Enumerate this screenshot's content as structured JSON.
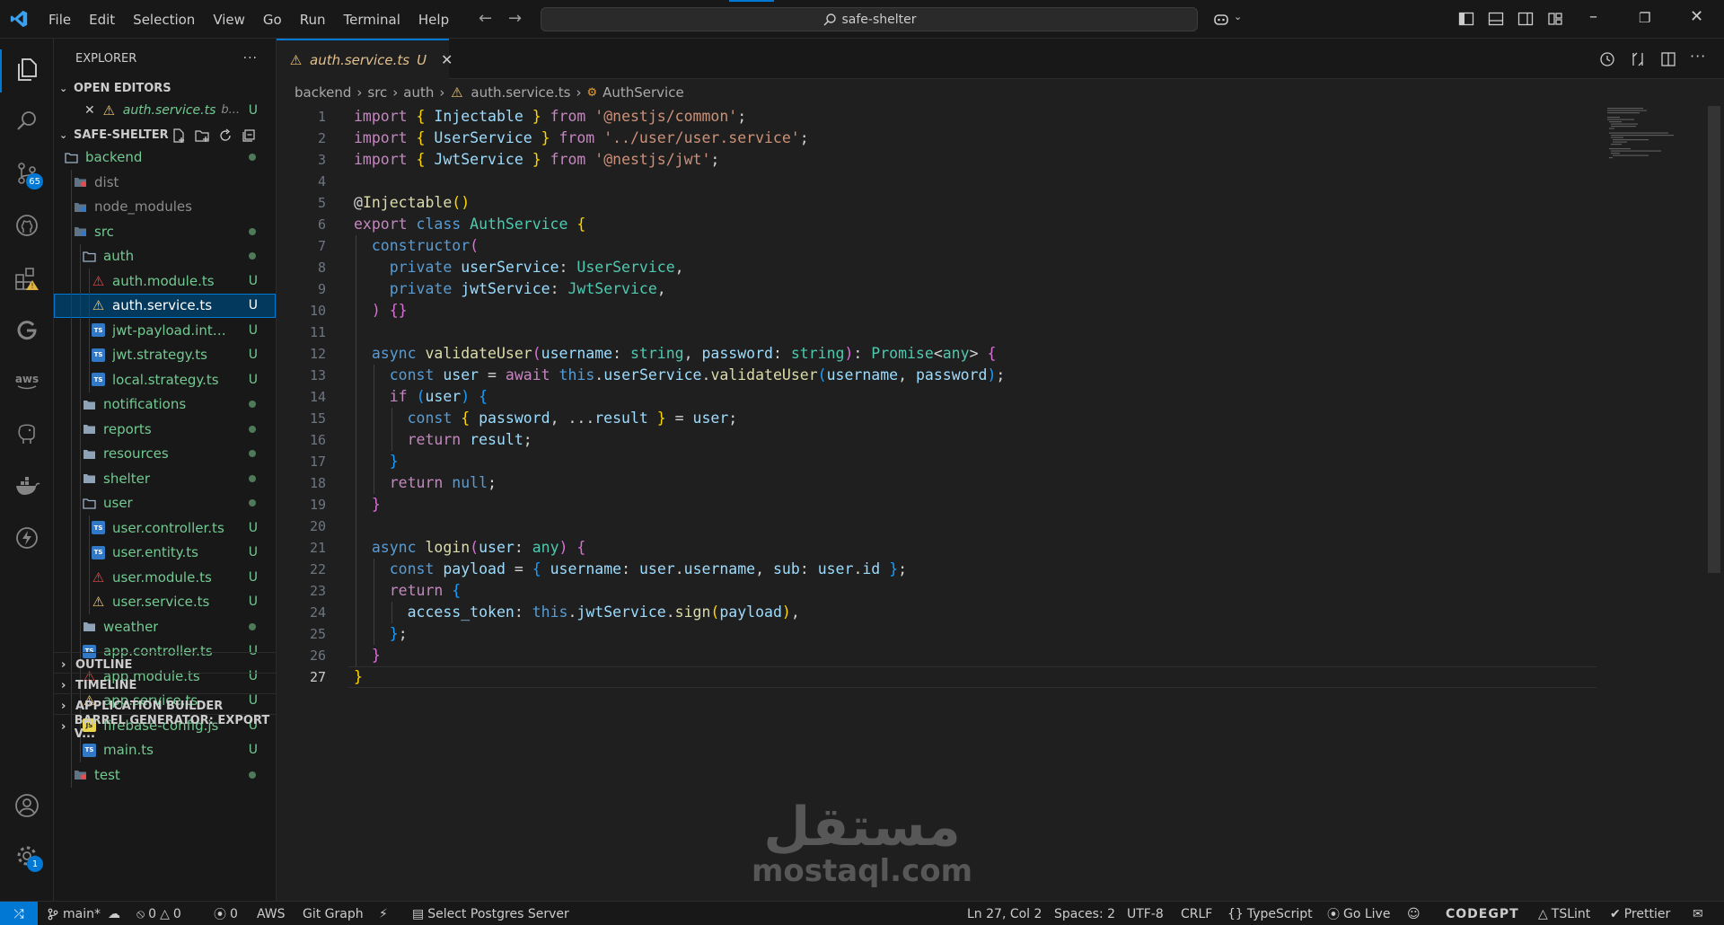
{
  "titlebar": {
    "menu": [
      "File",
      "Edit",
      "Selection",
      "View",
      "Go",
      "Run",
      "Terminal",
      "Help"
    ],
    "search": "safe-shelter"
  },
  "activity_bar": {
    "source_control_badge": "65",
    "settings_badge": "1"
  },
  "sidebar": {
    "title": "EXPLORER",
    "more": "···",
    "open_editors": {
      "label": "OPEN EDITORS",
      "items": [
        {
          "name": "auth.service.ts",
          "path": "b...",
          "status": "U"
        }
      ]
    },
    "project": {
      "label": "SAFE-SHELTER"
    },
    "tree": [
      {
        "name": "backend",
        "kind": "folder",
        "depth": 0,
        "open": true,
        "status": "dot"
      },
      {
        "name": "dist",
        "kind": "folder-special",
        "depth": 1,
        "open": false,
        "status": ""
      },
      {
        "name": "node_modules",
        "kind": "folder-special",
        "depth": 1,
        "open": false,
        "status": ""
      },
      {
        "name": "src",
        "kind": "folder-special",
        "depth": 1,
        "open": true,
        "status": "dot"
      },
      {
        "name": "auth",
        "kind": "folder",
        "depth": 2,
        "open": true,
        "status": "dot"
      },
      {
        "name": "auth.module.ts",
        "kind": "ang",
        "depth": 3,
        "status": "U"
      },
      {
        "name": "auth.service.ts",
        "kind": "svc",
        "depth": 3,
        "status": "U",
        "selected": true
      },
      {
        "name": "jwt-payload.interf...",
        "kind": "ts",
        "depth": 3,
        "status": "U"
      },
      {
        "name": "jwt.strategy.ts",
        "kind": "ts",
        "depth": 3,
        "status": "U"
      },
      {
        "name": "local.strategy.ts",
        "kind": "ts",
        "depth": 3,
        "status": "U"
      },
      {
        "name": "notifications",
        "kind": "folder",
        "depth": 2,
        "open": false,
        "status": "dot"
      },
      {
        "name": "reports",
        "kind": "folder",
        "depth": 2,
        "open": false,
        "status": "dot"
      },
      {
        "name": "resources",
        "kind": "folder",
        "depth": 2,
        "open": false,
        "status": "dot"
      },
      {
        "name": "shelter",
        "kind": "folder",
        "depth": 2,
        "open": false,
        "status": "dot"
      },
      {
        "name": "user",
        "kind": "folder",
        "depth": 2,
        "open": true,
        "status": "dot"
      },
      {
        "name": "user.controller.ts",
        "kind": "ts",
        "depth": 3,
        "status": "U"
      },
      {
        "name": "user.entity.ts",
        "kind": "ts",
        "depth": 3,
        "status": "U"
      },
      {
        "name": "user.module.ts",
        "kind": "ang",
        "depth": 3,
        "status": "U"
      },
      {
        "name": "user.service.ts",
        "kind": "svc",
        "depth": 3,
        "status": "U"
      },
      {
        "name": "weather",
        "kind": "folder",
        "depth": 2,
        "open": false,
        "status": "dot"
      },
      {
        "name": "app.controller.ts",
        "kind": "ts",
        "depth": 2,
        "status": "U"
      },
      {
        "name": "app.module.ts",
        "kind": "ang",
        "depth": 2,
        "status": "U"
      },
      {
        "name": "app.service.ts",
        "kind": "svc",
        "depth": 2,
        "status": "U"
      },
      {
        "name": "firebase-config.js",
        "kind": "js",
        "depth": 2,
        "status": "U"
      },
      {
        "name": "main.ts",
        "kind": "ts",
        "depth": 2,
        "status": "U"
      },
      {
        "name": "test",
        "kind": "folder-special",
        "depth": 1,
        "open": false,
        "status": "dot"
      }
    ],
    "bottom_sections": [
      "OUTLINE",
      "TIMELINE",
      "APPLICATION BUILDER",
      "BARREL GENERATOR: EXPORT V..."
    ]
  },
  "editor": {
    "tab": {
      "label": "auth.service.ts",
      "status": "U"
    },
    "breadcrumb": [
      "backend",
      "src",
      "auth",
      "auth.service.ts",
      "AuthService"
    ],
    "current_line": 27,
    "lines": [
      [
        [
          "import",
          "k"
        ],
        [
          " ",
          "t"
        ],
        [
          "{",
          "p1"
        ],
        [
          " Injectable ",
          "v"
        ],
        [
          "}",
          "p1"
        ],
        [
          " ",
          "t"
        ],
        [
          "from",
          "k"
        ],
        [
          " ",
          "t"
        ],
        [
          "'@nestjs/common'",
          "s"
        ],
        [
          ";",
          "t"
        ]
      ],
      [
        [
          "import",
          "k"
        ],
        [
          " ",
          "t"
        ],
        [
          "{",
          "p1"
        ],
        [
          " UserService ",
          "v"
        ],
        [
          "}",
          "p1"
        ],
        [
          " ",
          "t"
        ],
        [
          "from",
          "k"
        ],
        [
          " ",
          "t"
        ],
        [
          "'../user/user.service'",
          "s"
        ],
        [
          ";",
          "t"
        ]
      ],
      [
        [
          "import",
          "k"
        ],
        [
          " ",
          "t"
        ],
        [
          "{",
          "p1"
        ],
        [
          " JwtService ",
          "v"
        ],
        [
          "}",
          "p1"
        ],
        [
          " ",
          "t"
        ],
        [
          "from",
          "k"
        ],
        [
          " ",
          "t"
        ],
        [
          "'@nestjs/jwt'",
          "s"
        ],
        [
          ";",
          "t"
        ]
      ],
      [],
      [
        [
          "@",
          "t"
        ],
        [
          "Injectable",
          "f"
        ],
        [
          "()",
          "p1"
        ]
      ],
      [
        [
          "export",
          "k"
        ],
        [
          " ",
          "t"
        ],
        [
          "class",
          "b"
        ],
        [
          " ",
          "t"
        ],
        [
          "AuthService",
          "c"
        ],
        [
          " ",
          "t"
        ],
        [
          "{",
          "p1"
        ]
      ],
      [
        [
          "  ",
          "t"
        ],
        [
          "constructor",
          "b"
        ],
        [
          "(",
          "p2"
        ]
      ],
      [
        [
          "    ",
          "t"
        ],
        [
          "private",
          "b"
        ],
        [
          " ",
          "t"
        ],
        [
          "userService",
          "v"
        ],
        [
          ": ",
          "t"
        ],
        [
          "UserService",
          "c"
        ],
        [
          ",",
          "t"
        ]
      ],
      [
        [
          "    ",
          "t"
        ],
        [
          "private",
          "b"
        ],
        [
          " ",
          "t"
        ],
        [
          "jwtService",
          "v"
        ],
        [
          ": ",
          "t"
        ],
        [
          "JwtService",
          "c"
        ],
        [
          ",",
          "t"
        ]
      ],
      [
        [
          "  ",
          "t"
        ],
        [
          ")",
          "p2"
        ],
        [
          " ",
          "t"
        ],
        [
          "{}",
          "p2"
        ]
      ],
      [],
      [
        [
          "  ",
          "t"
        ],
        [
          "async",
          "b"
        ],
        [
          " ",
          "t"
        ],
        [
          "validateUser",
          "f"
        ],
        [
          "(",
          "p2"
        ],
        [
          "username",
          "v"
        ],
        [
          ": ",
          "t"
        ],
        [
          "string",
          "c"
        ],
        [
          ", ",
          "t"
        ],
        [
          "password",
          "v"
        ],
        [
          ": ",
          "t"
        ],
        [
          "string",
          "c"
        ],
        [
          ")",
          "p2"
        ],
        [
          ": ",
          "t"
        ],
        [
          "Promise",
          "c"
        ],
        [
          "<",
          "t"
        ],
        [
          "any",
          "c"
        ],
        [
          ">",
          "t"
        ],
        [
          " ",
          "t"
        ],
        [
          "{",
          "p2"
        ]
      ],
      [
        [
          "    ",
          "t"
        ],
        [
          "const",
          "b"
        ],
        [
          " ",
          "t"
        ],
        [
          "user",
          "v"
        ],
        [
          " = ",
          "t"
        ],
        [
          "await",
          "k"
        ],
        [
          " ",
          "t"
        ],
        [
          "this",
          "b"
        ],
        [
          ".",
          "t"
        ],
        [
          "userService",
          "v"
        ],
        [
          ".",
          "t"
        ],
        [
          "validateUser",
          "f"
        ],
        [
          "(",
          "p3"
        ],
        [
          "username",
          "v"
        ],
        [
          ", ",
          "t"
        ],
        [
          "password",
          "v"
        ],
        [
          ")",
          "p3"
        ],
        [
          ";",
          "t"
        ]
      ],
      [
        [
          "    ",
          "t"
        ],
        [
          "if",
          "k"
        ],
        [
          " ",
          "t"
        ],
        [
          "(",
          "p3"
        ],
        [
          "user",
          "v"
        ],
        [
          ")",
          "p3"
        ],
        [
          " ",
          "t"
        ],
        [
          "{",
          "p3"
        ]
      ],
      [
        [
          "      ",
          "t"
        ],
        [
          "const",
          "b"
        ],
        [
          " ",
          "t"
        ],
        [
          "{",
          "p1"
        ],
        [
          " ",
          "t"
        ],
        [
          "password",
          "v"
        ],
        [
          ", ...",
          "t"
        ],
        [
          "result",
          "v"
        ],
        [
          " ",
          "t"
        ],
        [
          "}",
          "p1"
        ],
        [
          " = ",
          "t"
        ],
        [
          "user",
          "v"
        ],
        [
          ";",
          "t"
        ]
      ],
      [
        [
          "      ",
          "t"
        ],
        [
          "return",
          "k"
        ],
        [
          " ",
          "t"
        ],
        [
          "result",
          "v"
        ],
        [
          ";",
          "t"
        ]
      ],
      [
        [
          "    ",
          "t"
        ],
        [
          "}",
          "p3"
        ]
      ],
      [
        [
          "    ",
          "t"
        ],
        [
          "return",
          "k"
        ],
        [
          " ",
          "t"
        ],
        [
          "null",
          "b"
        ],
        [
          ";",
          "t"
        ]
      ],
      [
        [
          "  ",
          "t"
        ],
        [
          "}",
          "p2"
        ]
      ],
      [],
      [
        [
          "  ",
          "t"
        ],
        [
          "async",
          "b"
        ],
        [
          " ",
          "t"
        ],
        [
          "login",
          "f"
        ],
        [
          "(",
          "p2"
        ],
        [
          "user",
          "v"
        ],
        [
          ": ",
          "t"
        ],
        [
          "any",
          "c"
        ],
        [
          ")",
          "p2"
        ],
        [
          " ",
          "t"
        ],
        [
          "{",
          "p2"
        ]
      ],
      [
        [
          "    ",
          "t"
        ],
        [
          "const",
          "b"
        ],
        [
          " ",
          "t"
        ],
        [
          "payload",
          "v"
        ],
        [
          " = ",
          "t"
        ],
        [
          "{",
          "p3"
        ],
        [
          " ",
          "t"
        ],
        [
          "username",
          "v"
        ],
        [
          ": ",
          "t"
        ],
        [
          "user",
          "v"
        ],
        [
          ".",
          "t"
        ],
        [
          "username",
          "v"
        ],
        [
          ", ",
          "t"
        ],
        [
          "sub",
          "v"
        ],
        [
          ": ",
          "t"
        ],
        [
          "user",
          "v"
        ],
        [
          ".",
          "t"
        ],
        [
          "id",
          "v"
        ],
        [
          " ",
          "t"
        ],
        [
          "}",
          "p3"
        ],
        [
          ";",
          "t"
        ]
      ],
      [
        [
          "    ",
          "t"
        ],
        [
          "return",
          "k"
        ],
        [
          " ",
          "t"
        ],
        [
          "{",
          "p3"
        ]
      ],
      [
        [
          "      ",
          "t"
        ],
        [
          "access_token",
          "v"
        ],
        [
          ": ",
          "t"
        ],
        [
          "this",
          "b"
        ],
        [
          ".",
          "t"
        ],
        [
          "jwtService",
          "v"
        ],
        [
          ".",
          "t"
        ],
        [
          "sign",
          "f"
        ],
        [
          "(",
          "p1"
        ],
        [
          "payload",
          "v"
        ],
        [
          ")",
          "p1"
        ],
        [
          ",",
          "t"
        ]
      ],
      [
        [
          "    ",
          "t"
        ],
        [
          "}",
          "p3"
        ],
        [
          ";",
          "t"
        ]
      ],
      [
        [
          "  ",
          "t"
        ],
        [
          "}",
          "p2"
        ]
      ],
      [
        [
          "}",
          "p1"
        ]
      ]
    ]
  },
  "watermark": {
    "arabic": "مستقل",
    "latin": "mostaql.com"
  },
  "statusbar": {
    "branch": "main*",
    "errors": "0",
    "warnings": "0",
    "ports": "0",
    "aws": "AWS",
    "git_graph": "Git Graph",
    "postgres": "Select Postgres Server",
    "position": "Ln 27, Col 2",
    "spaces": "Spaces: 2",
    "encoding": "UTF-8",
    "eol": "CRLF",
    "language": "TypeScript",
    "golive": "Go Live",
    "codegpt": "CODEGPT",
    "tslint": "TSLint",
    "prettier": "Prettier"
  },
  "colors": {
    "accent": "#0078d4",
    "untracked": "#73c991",
    "modified_tab": "#e2c08d"
  }
}
